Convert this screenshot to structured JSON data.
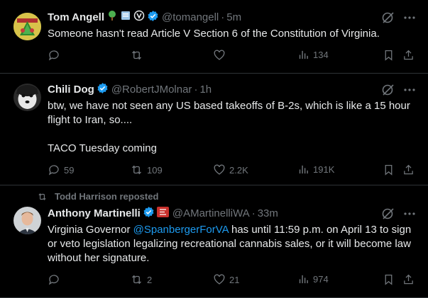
{
  "tweets": [
    {
      "name": "Tom Angell",
      "handle": "@tomangell",
      "sep": "·",
      "time": "5m",
      "text": "Someone hasn't read Article V Section 6 of the Constitution of Virginia.",
      "actions": {
        "replies": "",
        "reposts": "",
        "likes": "",
        "views": "134"
      }
    },
    {
      "name": "Chili Dog",
      "handle": "@RobertJMolnar",
      "sep": "·",
      "time": "1h",
      "text_line1": "btw, we have not seen any US based takeoffs of B-2s, which is like a 15 hour flight to Iran, so....",
      "text_line2": "TACO Tuesday coming",
      "actions": {
        "replies": "59",
        "reposts": "109",
        "likes": "2.2K",
        "views": "191K"
      }
    },
    {
      "reposted_by": "Todd Harrison reposted",
      "name": "Anthony Martinelli",
      "handle": "@AMartinelliWA",
      "sep": "·",
      "time": "33m",
      "text_before": "Virginia Governor ",
      "mention": "@SpanbergerForVA",
      "text_after": " has until 11:59 p.m. on April 13 to sign or veto legislation legalizing recreational cannabis sales, or it will become law without her signature.",
      "actions": {
        "replies": "",
        "reposts": "2",
        "likes": "21",
        "views": "974"
      }
    }
  ],
  "icons": [
    "reply-icon",
    "repost-icon",
    "like-icon",
    "views-icon",
    "bookmark-icon",
    "share-icon",
    "grok-icon",
    "more-icon",
    "verified-badge-icon"
  ],
  "colors": {
    "background": "#000000",
    "text": "#e7e9ea",
    "muted": "#71767b",
    "accent": "#1d9bf0",
    "divider": "#2f3336"
  }
}
